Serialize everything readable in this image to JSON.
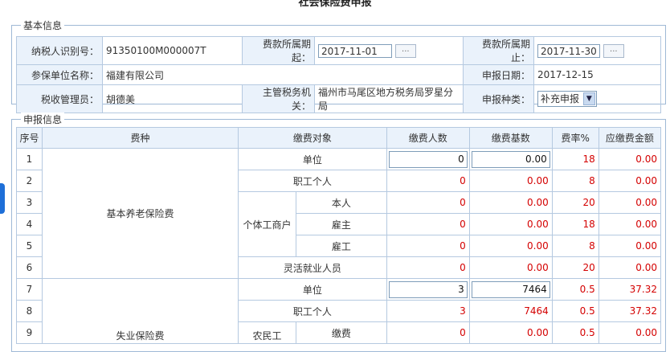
{
  "page_title": "社会保险费申报",
  "basic": {
    "legend": "基本信息",
    "taxpayer_id_label": "纳税人识别号：",
    "taxpayer_id": "91350100M000007T",
    "period_start_label": "费款所属期起：",
    "period_start": "2017-11-01",
    "period_end_label": "费款所属期止：",
    "period_end": "2017-11-30",
    "dots": "...",
    "unit_name_label": "参保单位名称：",
    "unit_name": "福建有限公司",
    "declare_date_label": "申报日期：",
    "declare_date": "2017-12-15",
    "tax_officer_label": "税收管理员：",
    "tax_officer": "胡德美",
    "tax_office_label": "主管税务机关：",
    "tax_office": "福州市马尾区地方税务局罗星分局",
    "declare_type_label": "申报种类：",
    "declare_type": "补充申报"
  },
  "declaration": {
    "legend": "申报信息",
    "headers": [
      "序号",
      "费种",
      "缴费对象",
      "缴费人数",
      "缴费基数",
      "费率%",
      "应缴费金额"
    ],
    "fee_types": [
      "基本养老保险费",
      "失业保险费"
    ],
    "groups": [
      "个体工商户",
      "农民工"
    ],
    "rows": [
      {
        "no": "1",
        "object": "单位",
        "count": "0",
        "base": "0.00",
        "rate": "18",
        "amount": "0.00"
      },
      {
        "no": "2",
        "object": "职工个人",
        "count": "0",
        "base": "0.00",
        "rate": "8",
        "amount": "0.00"
      },
      {
        "no": "3",
        "object": "本人",
        "count": "0",
        "base": "0.00",
        "rate": "20",
        "amount": "0.00"
      },
      {
        "no": "4",
        "object": "雇主",
        "count": "0",
        "base": "0.00",
        "rate": "18",
        "amount": "0.00"
      },
      {
        "no": "5",
        "object": "雇工",
        "count": "0",
        "base": "0.00",
        "rate": "8",
        "amount": "0.00"
      },
      {
        "no": "6",
        "object": "灵活就业人员",
        "count": "0",
        "base": "0.00",
        "rate": "20",
        "amount": "0.00"
      },
      {
        "no": "7",
        "object": "单位",
        "count": "3",
        "base": "7464",
        "rate": "0.5",
        "amount": "37.32"
      },
      {
        "no": "8",
        "object": "职工个人",
        "count": "3",
        "base": "7464",
        "rate": "0.5",
        "amount": "37.32"
      },
      {
        "no": "9",
        "object": "缴费",
        "count": "0",
        "base": "0.00",
        "rate": "0.5",
        "amount": "0.00"
      }
    ]
  },
  "colors": {
    "accent": "#1e6fd8",
    "border": "#b5c9e0",
    "value_red": "#d40000",
    "label_bg": "#eaf2fb"
  }
}
